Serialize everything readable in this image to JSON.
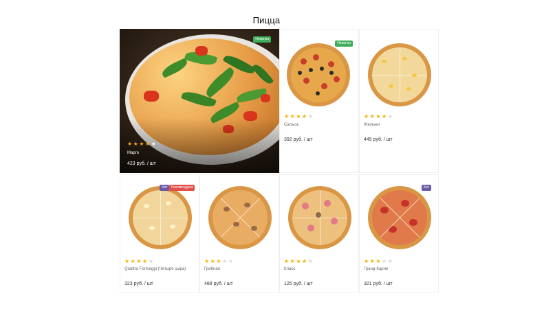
{
  "page": {
    "title": "Пицца"
  },
  "colors": {
    "star_on": "#f5b100",
    "star_off": "#d8d8d8",
    "badge_new": "#3fae5a",
    "badge_hit": "#6c5aa6",
    "badge_recommend": "#e2504a"
  },
  "products": [
    {
      "id": "margo",
      "name": "Марго",
      "price": "423 руб. / шт",
      "rating": 4,
      "badges": [
        {
          "label": "Новинка",
          "color": "green"
        }
      ]
    },
    {
      "id": "salsa",
      "name": "Сальса",
      "price": "392 руб. / шт",
      "rating": 4,
      "badges": [
        {
          "label": "Новинка",
          "color": "green"
        }
      ]
    },
    {
      "id": "julienne",
      "name": "Жюльен",
      "price": "445 руб. / шт",
      "rating": 4,
      "badges": []
    },
    {
      "id": "quattro",
      "name": "Quattro Formaggi (Четыре сыра)",
      "price": "323 руб. / шт",
      "rating": 4,
      "badges": [
        {
          "label": "Хит",
          "color": "purple"
        },
        {
          "label": "Рекомендуем",
          "color": "red"
        }
      ]
    },
    {
      "id": "mushroom",
      "name": "Грибная",
      "price": "488 руб. / шт",
      "rating": 3,
      "badges": []
    },
    {
      "id": "classic",
      "name": "Класс",
      "price": "125 руб. / шт",
      "rating": 4,
      "badges": []
    },
    {
      "id": "grand-carne",
      "name": "Гранд-Карне",
      "price": "321 руб. / шт",
      "rating": 3,
      "badges": [
        {
          "label": "Хит",
          "color": "purple"
        }
      ]
    }
  ]
}
